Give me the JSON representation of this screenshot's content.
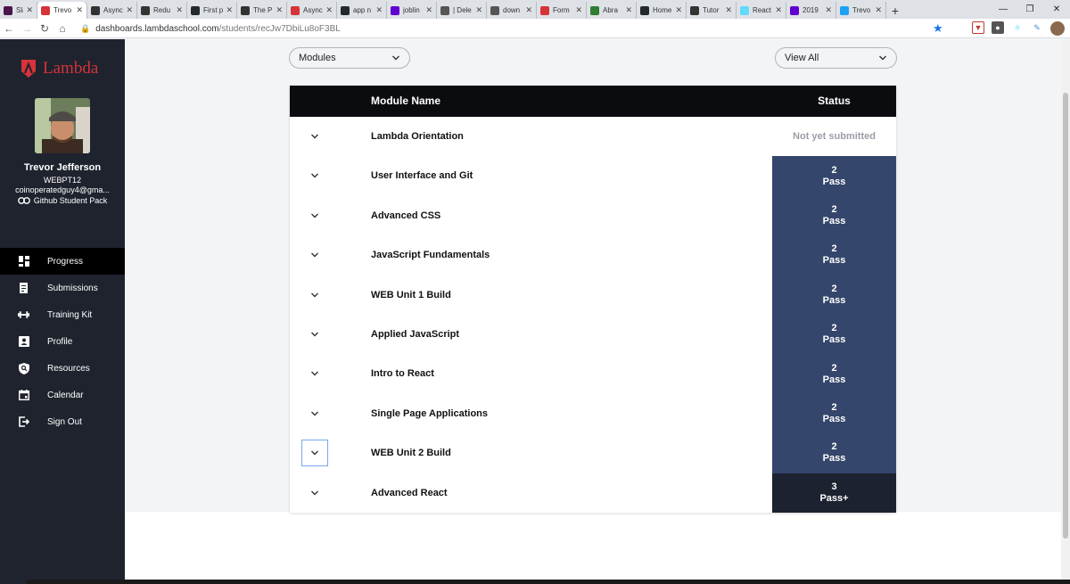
{
  "browser": {
    "tabs": [
      {
        "title": "Slack",
        "color": "#4a154b"
      },
      {
        "title": "Trevo",
        "color": "#d6333a",
        "active": true
      },
      {
        "title": "Async",
        "color": "#333333"
      },
      {
        "title": "Redu",
        "color": "#333333"
      },
      {
        "title": "First p",
        "color": "#24292e"
      },
      {
        "title": "The P",
        "color": "#333333"
      },
      {
        "title": "Async",
        "color": "#d6333a"
      },
      {
        "title": "app n",
        "color": "#24292e"
      },
      {
        "title": "joblin",
        "color": "#6001d2"
      },
      {
        "title": "| Dele",
        "color": "#555555"
      },
      {
        "title": "down",
        "color": "#555555"
      },
      {
        "title": "Form",
        "color": "#d6333a"
      },
      {
        "title": "Abra",
        "color": "#2e7d32"
      },
      {
        "title": "Home",
        "color": "#24292e"
      },
      {
        "title": "Tutor",
        "color": "#333333"
      },
      {
        "title": "React",
        "color": "#61dafb"
      },
      {
        "title": "2019",
        "color": "#6001d2"
      },
      {
        "title": "Trevo",
        "color": "#1da1f2"
      }
    ],
    "url_host": "dashboards.lambdaschool.com",
    "url_path": "/students/recJw7DbiLu8oF3BL"
  },
  "sidebar": {
    "logo_text": "Lambda",
    "user": {
      "name": "Trevor Jefferson",
      "cohort": "WEBPT12",
      "email": "coinoperatedguy4@gma...",
      "github_pack": "Github Student Pack"
    },
    "nav": [
      {
        "label": "Progress",
        "icon": "dashboard-icon",
        "active": true
      },
      {
        "label": "Submissions",
        "icon": "document-icon"
      },
      {
        "label": "Training Kit",
        "icon": "dumbbell-icon"
      },
      {
        "label": "Profile",
        "icon": "person-card-icon"
      },
      {
        "label": "Resources",
        "icon": "shield-search-icon"
      },
      {
        "label": "Calendar",
        "icon": "calendar-icon"
      },
      {
        "label": "Sign Out",
        "icon": "sign-out-icon"
      }
    ]
  },
  "filters": {
    "modules_select": "Modules",
    "view_select": "View All"
  },
  "table": {
    "header_name": "Module Name",
    "header_status": "Status",
    "rows": [
      {
        "name": "Lambda Orientation",
        "status_type": "none",
        "status_text": "Not yet submitted"
      },
      {
        "name": "User Interface and Git",
        "status_type": "pass",
        "score": "2",
        "status_text": "Pass"
      },
      {
        "name": "Advanced CSS",
        "status_type": "pass",
        "score": "2",
        "status_text": "Pass"
      },
      {
        "name": "JavaScript Fundamentals",
        "status_type": "pass",
        "score": "2",
        "status_text": "Pass"
      },
      {
        "name": "WEB Unit 1 Build",
        "status_type": "pass",
        "score": "2",
        "status_text": "Pass"
      },
      {
        "name": "Applied JavaScript",
        "status_type": "pass",
        "score": "2",
        "status_text": "Pass"
      },
      {
        "name": "Intro to React",
        "status_type": "pass",
        "score": "2",
        "status_text": "Pass"
      },
      {
        "name": "Single Page Applications",
        "status_type": "pass",
        "score": "2",
        "status_text": "Pass"
      },
      {
        "name": "WEB Unit 2 Build",
        "status_type": "pass",
        "score": "2",
        "status_text": "Pass",
        "focused": true
      },
      {
        "name": "Advanced React",
        "status_type": "passplus",
        "score": "3",
        "status_text": "Pass+"
      }
    ]
  },
  "colors": {
    "brand": "#d6333a",
    "sidebar_bg": "#1f232e",
    "pass_bg": "#34466b",
    "passplus_bg": "#1c2230"
  }
}
